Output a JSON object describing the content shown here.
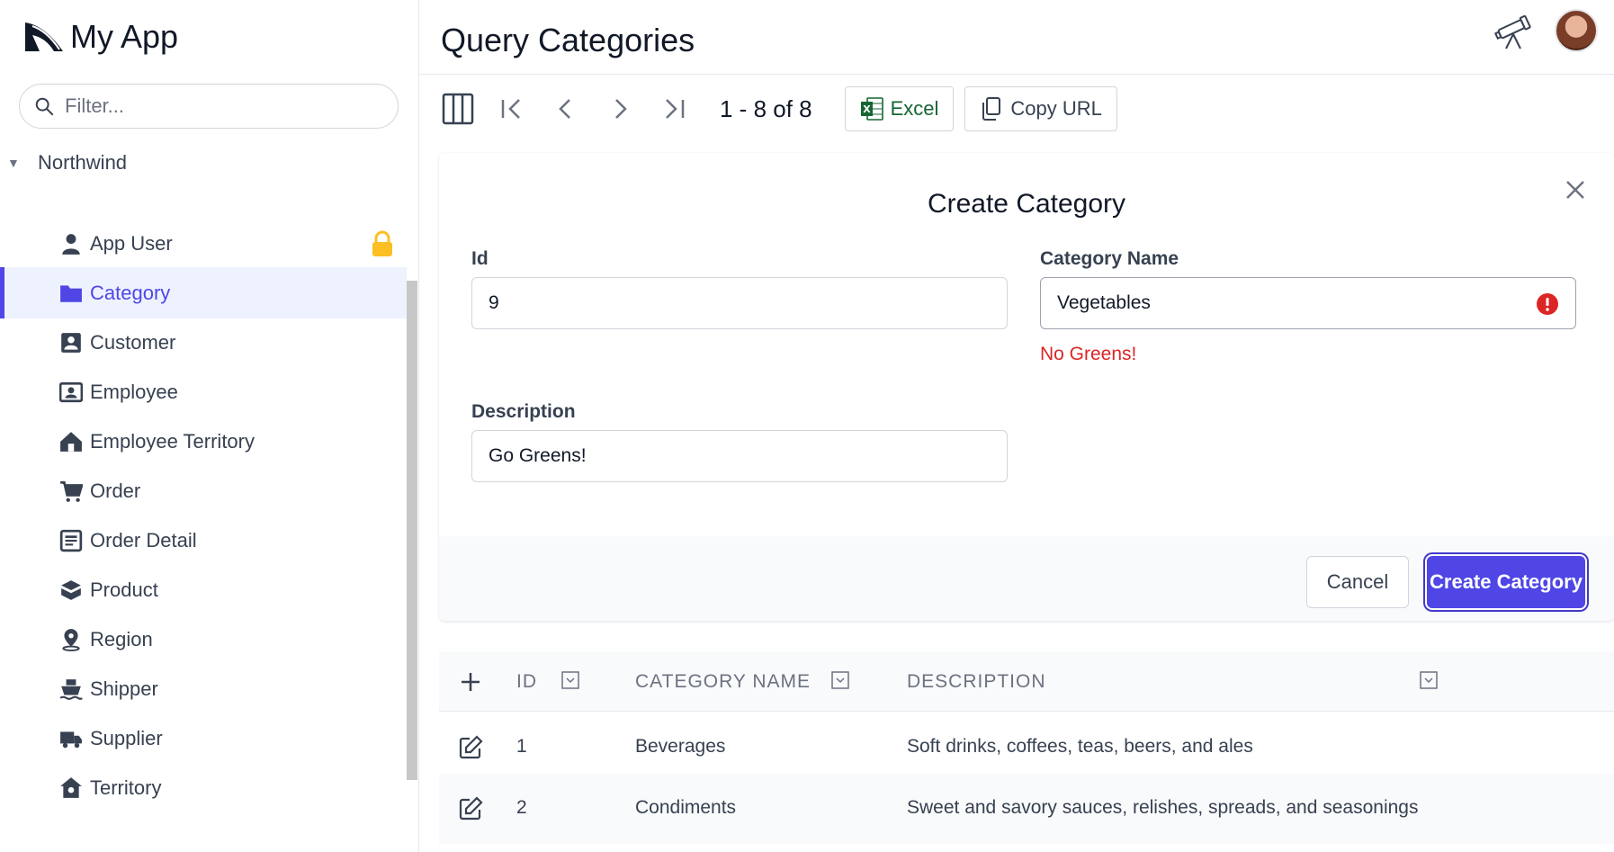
{
  "app": {
    "title": "My App"
  },
  "sidebar": {
    "filter_placeholder": "Filter...",
    "group": "Northwind",
    "items": [
      {
        "label": "App User",
        "icon": "user-icon",
        "locked": true
      },
      {
        "label": "Category",
        "icon": "folder-icon",
        "active": true
      },
      {
        "label": "Customer",
        "icon": "contact-icon"
      },
      {
        "label": "Employee",
        "icon": "id-card-icon"
      },
      {
        "label": "Employee Territory",
        "icon": "house-icon"
      },
      {
        "label": "Order",
        "icon": "cart-icon"
      },
      {
        "label": "Order Detail",
        "icon": "receipt-icon"
      },
      {
        "label": "Product",
        "icon": "box-icon"
      },
      {
        "label": "Region",
        "icon": "map-pin-icon"
      },
      {
        "label": "Shipper",
        "icon": "ship-icon"
      },
      {
        "label": "Supplier",
        "icon": "truck-icon"
      },
      {
        "label": "Territory",
        "icon": "home-pin-icon"
      }
    ]
  },
  "header": {
    "title": "Query Categories"
  },
  "toolbar": {
    "paging": "1 - 8 of 8",
    "excel_label": "Excel",
    "copy_url_label": "Copy URL"
  },
  "form": {
    "title": "Create Category",
    "id_label": "Id",
    "id_value": "9",
    "name_label": "Category Name",
    "name_value": "Vegetables",
    "name_error": "No Greens!",
    "desc_label": "Description",
    "desc_value": "Go Greens!",
    "cancel_label": "Cancel",
    "submit_label": "Create Category"
  },
  "table": {
    "columns": [
      "ID",
      "CATEGORY NAME",
      "DESCRIPTION"
    ],
    "rows": [
      {
        "id": "1",
        "name": "Beverages",
        "description": "Soft drinks, coffees, teas, beers, and ales"
      },
      {
        "id": "2",
        "name": "Condiments",
        "description": "Sweet and savory sauces, relishes, spreads, and seasonings"
      }
    ]
  },
  "colors": {
    "accent": "#4f46e5",
    "error": "#dc2626",
    "lock": "#fbbf24",
    "excel": "#166534"
  }
}
